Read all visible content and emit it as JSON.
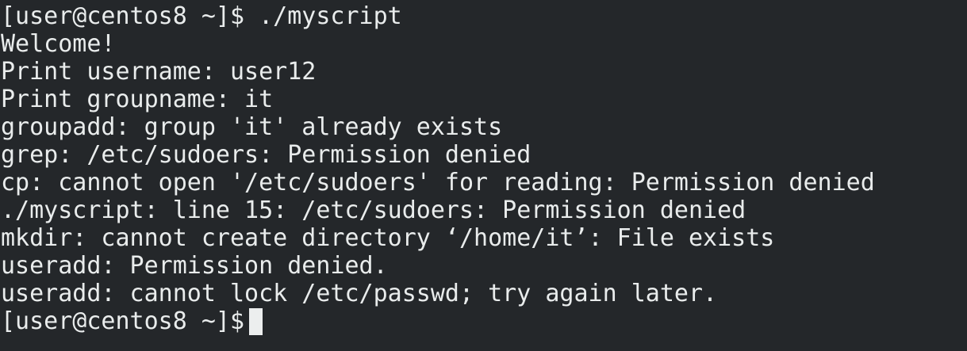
{
  "terminal": {
    "lines": [
      "[user@centos8 ~]$ ./myscript",
      "Welcome!",
      "Print username: user12",
      "Print groupname: it",
      "groupadd: group 'it' already exists",
      "grep: /etc/sudoers: Permission denied",
      "cp: cannot open '/etc/sudoers' for reading: Permission denied",
      "./myscript: line 15: /etc/sudoers: Permission denied",
      "mkdir: cannot create directory ‘/home/it’: File exists",
      "useradd: Permission denied.",
      "useradd: cannot lock /etc/passwd; try again later."
    ],
    "prompt": "[user@centos8 ~]$",
    "colors": {
      "background": "#24272a",
      "foreground": "#e9ecec",
      "cursor": "#eceeee"
    }
  }
}
